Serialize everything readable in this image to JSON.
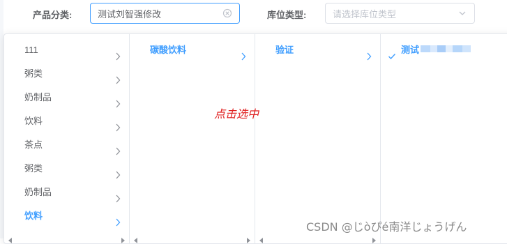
{
  "form": {
    "category_label": "产品分类:",
    "category_value": "测试刘智强修改",
    "location_label": "库位类型:",
    "location_placeholder": "请选择库位类型"
  },
  "cascader": {
    "level1": [
      {
        "label": "111",
        "has_children": true
      },
      {
        "label": "粥类",
        "has_children": true
      },
      {
        "label": "奶制品",
        "has_children": true
      },
      {
        "label": "饮料",
        "has_children": true
      },
      {
        "label": "茶点",
        "has_children": true
      },
      {
        "label": "粥类",
        "has_children": true
      },
      {
        "label": "奶制品",
        "has_children": true
      },
      {
        "label": "饮料",
        "has_children": true,
        "active": true
      }
    ],
    "level2": [
      {
        "label": "碳酸饮料",
        "has_children": true,
        "active": true
      }
    ],
    "level3": [
      {
        "label": "验证",
        "has_children": true,
        "active": true
      }
    ],
    "level4": [
      {
        "label": "测试",
        "selected": true
      }
    ]
  },
  "annotation": "点击选中",
  "watermark": "CSDN @じòぴé南洋じょうげん",
  "colors": {
    "accent": "#409eff",
    "annotation": "#e02020"
  }
}
